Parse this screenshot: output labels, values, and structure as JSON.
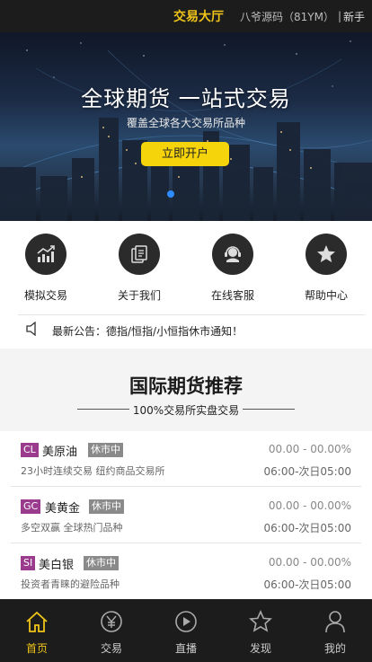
{
  "topbar": {
    "title": "交易大厅",
    "user": "八爷源码（81YM）",
    "separator": "|",
    "newbie": "新手"
  },
  "banner": {
    "headline": "全球期货 一站式交易",
    "subline": "覆盖全球各大交易所品种",
    "cta": "立即开户",
    "accent": "#f5d40c"
  },
  "quick_menu": [
    {
      "label": "模拟交易",
      "icon": "chart-icon"
    },
    {
      "label": "关于我们",
      "icon": "document-icon"
    },
    {
      "label": "在线客服",
      "icon": "headset-icon"
    },
    {
      "label": "帮助中心",
      "icon": "star-icon"
    }
  ],
  "notice": {
    "icon": "speaker-icon",
    "text": "最新公告：德指/恒指/小恒指休市通知！"
  },
  "section": {
    "title": "国际期货推荐",
    "subtitle": "100%交易所实盘交易"
  },
  "products": [
    {
      "code": "CL",
      "name": "美原油",
      "status": "休市中",
      "desc": "23小时连续交易 纽约商品交易所",
      "change": "00.00 - 00.00%",
      "hours": "06:00-次日05:00"
    },
    {
      "code": "GC",
      "name": "美黄金",
      "status": "休市中",
      "desc": "多空双赢 全球热门品种",
      "change": "00.00 - 00.00%",
      "hours": "06:00-次日05:00"
    },
    {
      "code": "SI",
      "name": "美白银",
      "status": "休市中",
      "desc": "投资者青睐的避险品种",
      "change": "00.00 - 00.00%",
      "hours": "06:00-次日05:00"
    }
  ],
  "bottom_nav": [
    {
      "label": "首页",
      "icon": "home-icon",
      "active": true
    },
    {
      "label": "交易",
      "icon": "yuan-icon",
      "active": false
    },
    {
      "label": "直播",
      "icon": "play-icon",
      "active": false
    },
    {
      "label": "发现",
      "icon": "star-outline-icon",
      "active": false
    },
    {
      "label": "我的",
      "icon": "user-icon",
      "active": false
    }
  ],
  "colors": {
    "brand_yellow": "#f0c419",
    "dark_bg": "#1c1c1c",
    "code_badge": "#9b3b8e",
    "status_badge": "#8a8a8a"
  }
}
